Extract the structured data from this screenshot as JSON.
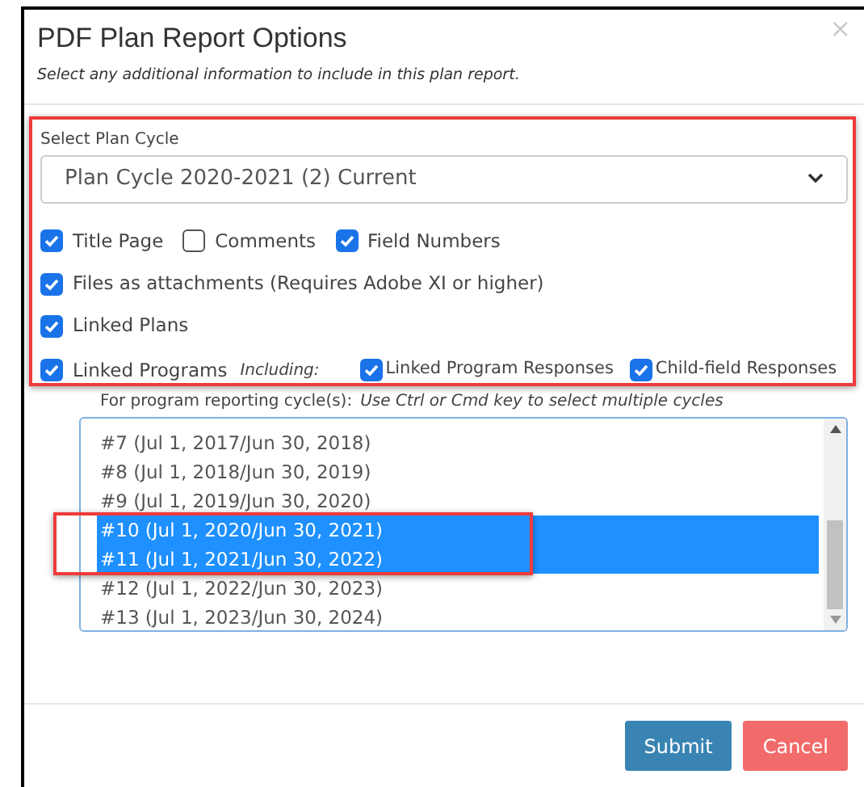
{
  "dialog": {
    "title": "PDF Plan Report Options",
    "subtitle": "Select any additional information to include in this plan report.",
    "close": "×"
  },
  "plan_cycle": {
    "label": "Select Plan Cycle",
    "value": "Plan Cycle 2020-2021 (2) Current"
  },
  "option_rows": [
    [
      {
        "label": "Title Page",
        "checked": true
      },
      {
        "label": "Comments",
        "checked": false
      },
      {
        "label": "Field Numbers",
        "checked": true
      }
    ],
    [
      {
        "label": "Files as attachments (Requires Adobe XI or higher)",
        "checked": true
      }
    ],
    [
      {
        "label": "Linked Plans",
        "checked": true
      }
    ]
  ],
  "linked_programs": {
    "label": "Linked Programs",
    "checked": true,
    "including": "Including:",
    "suboptions": [
      {
        "label": "Linked Program Responses",
        "checked": true
      },
      {
        "label": "Child-field Responses",
        "checked": true
      }
    ]
  },
  "cycles_hint": {
    "label": "For program reporting cycle(s):",
    "note": "Use Ctrl or Cmd key to select multiple cycles"
  },
  "cycles": [
    {
      "label": "#7 (Jul 1, 2017/Jun 30, 2018)",
      "selected": false
    },
    {
      "label": "#8 (Jul 1, 2018/Jun 30, 2019)",
      "selected": false
    },
    {
      "label": "#9 (Jul 1, 2019/Jun 30, 2020)",
      "selected": false
    },
    {
      "label": "#10 (Jul 1, 2020/Jun 30, 2021)",
      "selected": true
    },
    {
      "label": "#11 (Jul 1, 2021/Jun 30, 2022)",
      "selected": true
    },
    {
      "label": "#12 (Jul 1, 2022/Jun 30, 2023)",
      "selected": false
    },
    {
      "label": "#13 (Jul 1, 2023/Jun 30, 2024)",
      "selected": false
    }
  ],
  "buttons": [
    {
      "label": "Submit",
      "kind": "primary"
    },
    {
      "label": "Cancel",
      "kind": "danger"
    }
  ]
}
